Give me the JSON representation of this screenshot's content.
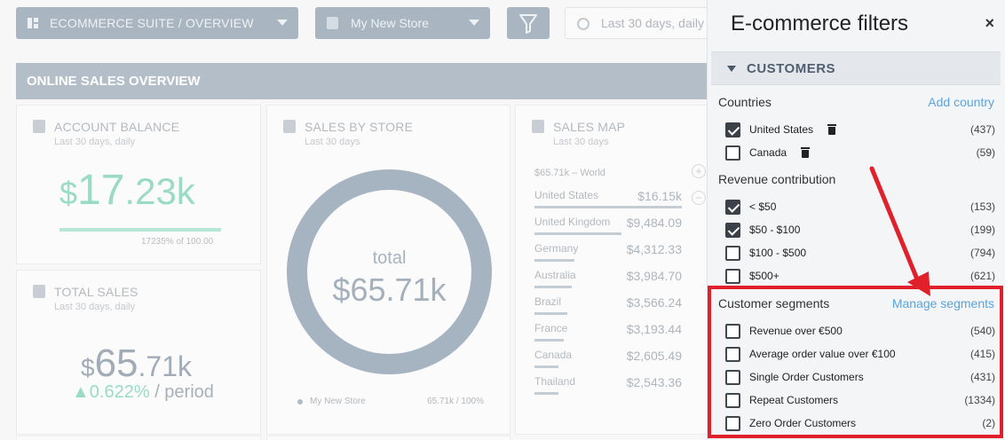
{
  "toolbar": {
    "dashboard_select": "ECOMMERCE SUITE / OVERVIEW",
    "store_select": "My New Store",
    "date_range": "Last 30 days, daily"
  },
  "section": {
    "title": "ONLINE SALES OVERVIEW"
  },
  "account_balance": {
    "title": "ACCOUNT BALANCE",
    "subtitle": "Last 30 days, daily",
    "currency": "$",
    "int": "17",
    "dec": ".23k",
    "bar_note_value": "17235%",
    "bar_note_of": "of 100.00"
  },
  "total_sales": {
    "title": "TOTAL SALES",
    "subtitle": "Last 30 days, daily",
    "currency": "$",
    "int": "65",
    "dec": ".71k",
    "delta": "▲0.622%",
    "delta_suffix": " / period"
  },
  "sales_by_store": {
    "title": "SALES BY STORE",
    "subtitle": "Last 30 days",
    "donut_label": "total",
    "donut_value": "$65.71k",
    "legend_name": "My New Store",
    "legend_value": "65.71k  /  100%"
  },
  "sales_map": {
    "title": "SALES MAP",
    "subtitle": "Last 30 days",
    "head": "$65.71k – World",
    "zoom_in": "+",
    "zoom_out": "−",
    "rows": [
      {
        "country": "United States",
        "value": "$16.15k",
        "fill": 1.0
      },
      {
        "country": "United Kingdom",
        "value": "$9,484.09",
        "fill": 0.59
      },
      {
        "country": "Germany",
        "value": "$4,312.33",
        "fill": 0.27
      },
      {
        "country": "Australia",
        "value": "$3,984.70",
        "fill": 0.25
      },
      {
        "country": "Brazil",
        "value": "$3,566.24",
        "fill": 0.22
      },
      {
        "country": "France",
        "value": "$3,193.44",
        "fill": 0.2
      },
      {
        "country": "Canada",
        "value": "$2,605.49",
        "fill": 0.16
      },
      {
        "country": "Thailand",
        "value": "$2,543.36",
        "fill": 0.16
      }
    ]
  },
  "panel": {
    "title": "E-commerce filters",
    "close": "×",
    "section": "CUSTOMERS",
    "countries": {
      "heading": "Countries",
      "link": "Add country",
      "items": [
        {
          "label": "United States",
          "count": "(437)",
          "checked": true
        },
        {
          "label": "Canada",
          "count": "(59)",
          "checked": false
        }
      ]
    },
    "revenue": {
      "heading": "Revenue contribution",
      "items": [
        {
          "label": "< $50",
          "count": "(153)",
          "checked": true
        },
        {
          "label": "$50 - $100",
          "count": "(199)",
          "checked": true
        },
        {
          "label": "$100 - $500",
          "count": "(794)",
          "checked": false
        },
        {
          "label": "$500+",
          "count": "(621)",
          "checked": false
        }
      ]
    },
    "segments": {
      "heading": "Customer segments",
      "link": "Manage segments",
      "items": [
        {
          "label": "Revenue over €500",
          "count": "(540)",
          "checked": false
        },
        {
          "label": "Average order value over €100",
          "count": "(415)",
          "checked": false
        },
        {
          "label": "Single Order Customers",
          "count": "(431)",
          "checked": false
        },
        {
          "label": "Repeat Customers",
          "count": "(1334)",
          "checked": false
        },
        {
          "label": "Zero Order Customers",
          "count": "(2)",
          "checked": false
        }
      ]
    }
  },
  "colors": {
    "highlight": "#e0202a",
    "link": "#5aa4db",
    "accent_green": "#9adbc6"
  }
}
